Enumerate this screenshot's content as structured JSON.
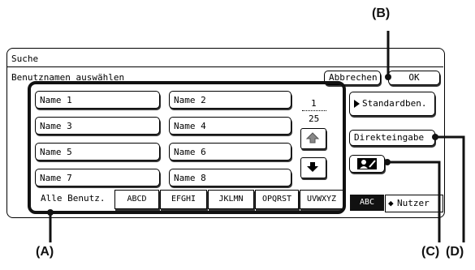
{
  "window": {
    "title": "Suche"
  },
  "header": {
    "subtitle": "Benutznamen auswählen",
    "cancel_label": "Abbrechen",
    "ok_label": "OK"
  },
  "names": [
    "Name 1",
    "Name 2",
    "Name 3",
    "Name 4",
    "Name 5",
    "Name 6",
    "Name 7",
    "Name 8"
  ],
  "pager": {
    "current": "1",
    "total": "25"
  },
  "side_buttons": {
    "standard_label": "Standardben.",
    "direct_label": "Direkteingabe"
  },
  "tabs": [
    "Alle Benutz.",
    "ABCD",
    "EFGHI",
    "JKLMN",
    "OPQRST",
    "UVWXYZ"
  ],
  "mode": {
    "active_label": "ABC",
    "other_label": "Nutzer"
  },
  "callouts": {
    "A": "(A)",
    "B": "(B)",
    "C": "(C)",
    "D": "(D)"
  },
  "colors": {
    "callout_line": "#111111",
    "active_mode_bg": "#111111"
  },
  "icons": {
    "up": "up-arrow-icon",
    "down": "down-arrow-icon",
    "standard": "play-triangle-icon",
    "user_edit": "user-edit-icon",
    "swap": "swap-arrows-icon"
  }
}
